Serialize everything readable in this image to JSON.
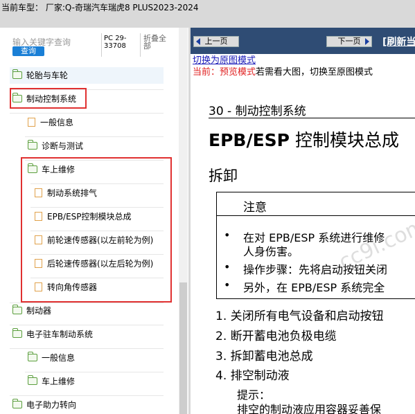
{
  "header": {
    "title": "当前车型：  厂家:Q-奇瑞汽车瑞虎8 PLUS2023-2024"
  },
  "sidebar": {
    "search_placeholder": "输入关键字查询",
    "search_button": "查询",
    "pc_code": "PC 29-33708",
    "collapse_all": "折叠全部",
    "items": [
      {
        "label": "轮胎与车轮",
        "type": "folder"
      },
      {
        "label": "制动控制系统",
        "type": "folder-open"
      },
      {
        "label": "一般信息",
        "type": "doc"
      },
      {
        "label": "诊断与测试",
        "type": "folder"
      },
      {
        "label": "车上维修",
        "type": "folder-open"
      },
      {
        "label": "制动系统排气",
        "type": "doc"
      },
      {
        "label": "EPB/ESP控制模块总成",
        "type": "doc"
      },
      {
        "label": "前轮速传感器(以左前轮为例)",
        "type": "doc"
      },
      {
        "label": "后轮速传感器(以左后轮为例)",
        "type": "doc"
      },
      {
        "label": "转向角传感器",
        "type": "doc"
      },
      {
        "label": "制动器",
        "type": "folder"
      },
      {
        "label": "电子驻车制动系统",
        "type": "folder"
      },
      {
        "label": "一般信息",
        "type": "folder"
      },
      {
        "label": "车上维修",
        "type": "folder"
      },
      {
        "label": "电子助力转向",
        "type": "folder"
      }
    ]
  },
  "toolbar": {
    "prev": "上一页",
    "next": "下一页",
    "refresh": "[刷新当"
  },
  "content": {
    "switch_link": "切换为原图模式",
    "preview_red": "当前：预览模式",
    "preview_black": "若需看大图，切换至原图模式",
    "section": "30 - 制动控制系统",
    "title_bold": "EPB/ESP",
    "title_rest": " 控制模块总成",
    "subtitle": "拆卸",
    "note_title": "注意",
    "note_bullets": [
      {
        "line1": "在对 EPB/ESP 系统进行维修",
        "line2": "人身伤害。"
      },
      {
        "line1": "操作步骤：先将启动按钮关闭"
      },
      {
        "line1": "另外，在 EPB/ESP 系统完全"
      }
    ],
    "steps": [
      "1.  关闭所有电气设备和启动按钮",
      "2.  断开蓄电池负极电缆",
      "3.  拆卸蓄电池总成",
      "4.  排空制动液"
    ],
    "hint_label": "提示：",
    "hint_text": "排空的制动液应用容器妥善保",
    "watermark": "cc9i.com"
  },
  "colors": {
    "toolbar_bg": "#2f4c74",
    "highlight_box": "#e03030",
    "preview_red": "#e02020",
    "link_blue": "#1a1ab8",
    "folder_green": "#5a9e3c",
    "doc_orange": "#e0a14a"
  }
}
